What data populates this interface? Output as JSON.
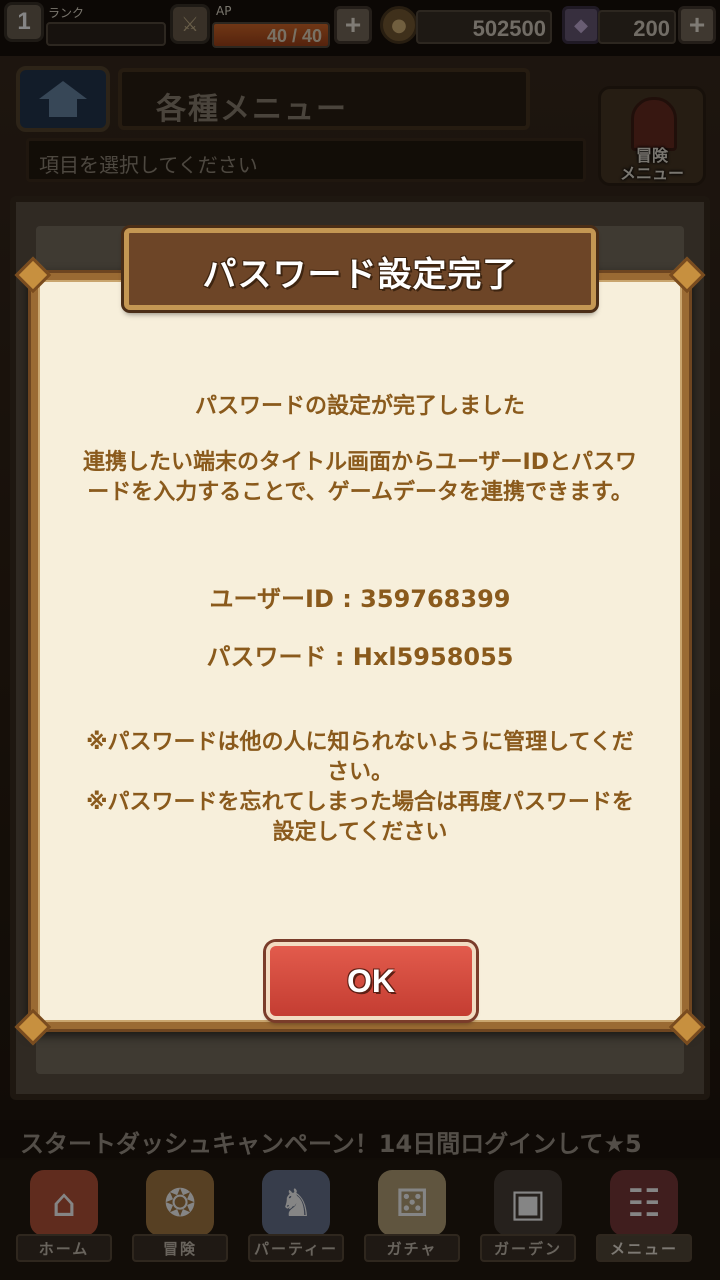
{
  "status_bar": {
    "level": "1",
    "rank_label": "ランク",
    "ap_label": "AP",
    "ap_value": "40 / 40",
    "ap_fill_fraction": 1.0,
    "coins": "502500",
    "gems": "200",
    "plus_symbol": "+"
  },
  "header": {
    "title": "各種メニュー",
    "subtitle": "項目を選択してください",
    "adventure_button_label": "冒険\nメニュー"
  },
  "ticker": {
    "text": "スタートダッシュキャンペーン！14日間ログインして★5"
  },
  "bottom_nav": {
    "items": [
      {
        "label": "ホーム",
        "icon": "house-icon",
        "color": "#b9553a"
      },
      {
        "label": "冒険",
        "icon": "compass-icon",
        "color": "#a77b44"
      },
      {
        "label": "パーティー",
        "icon": "chess-icon",
        "color": "#6a7690"
      },
      {
        "label": "ガチャ",
        "icon": "dice-icon",
        "color": "#b8a37a"
      },
      {
        "label": "ガーデン",
        "icon": "lock-icon",
        "color": "#4a4038"
      },
      {
        "label": "メニュー",
        "icon": "book-icon",
        "color": "#7c3b3b"
      }
    ],
    "active_index": 5
  },
  "dialog": {
    "title": "パスワード設定完了",
    "message_done": "パスワードの設定が完了しました",
    "message_link": "連携したい端末のタイトル画面からユーザーIDとパスワードを入力することで、ゲームデータを連携できます。",
    "user_id_line": "ユーザーID : 359768399",
    "password_line": "パスワード : Hxl5958055",
    "notes": "※パスワードは他の人に知られないように管理してください。\n※パスワードを忘れてしまった場合は再度パスワードを設定してください",
    "ok_label": "OK"
  },
  "colors": {
    "dialog_text": "#8a5a1c",
    "ok_button": "#d24b3e",
    "title_plate": "#6d4527"
  }
}
